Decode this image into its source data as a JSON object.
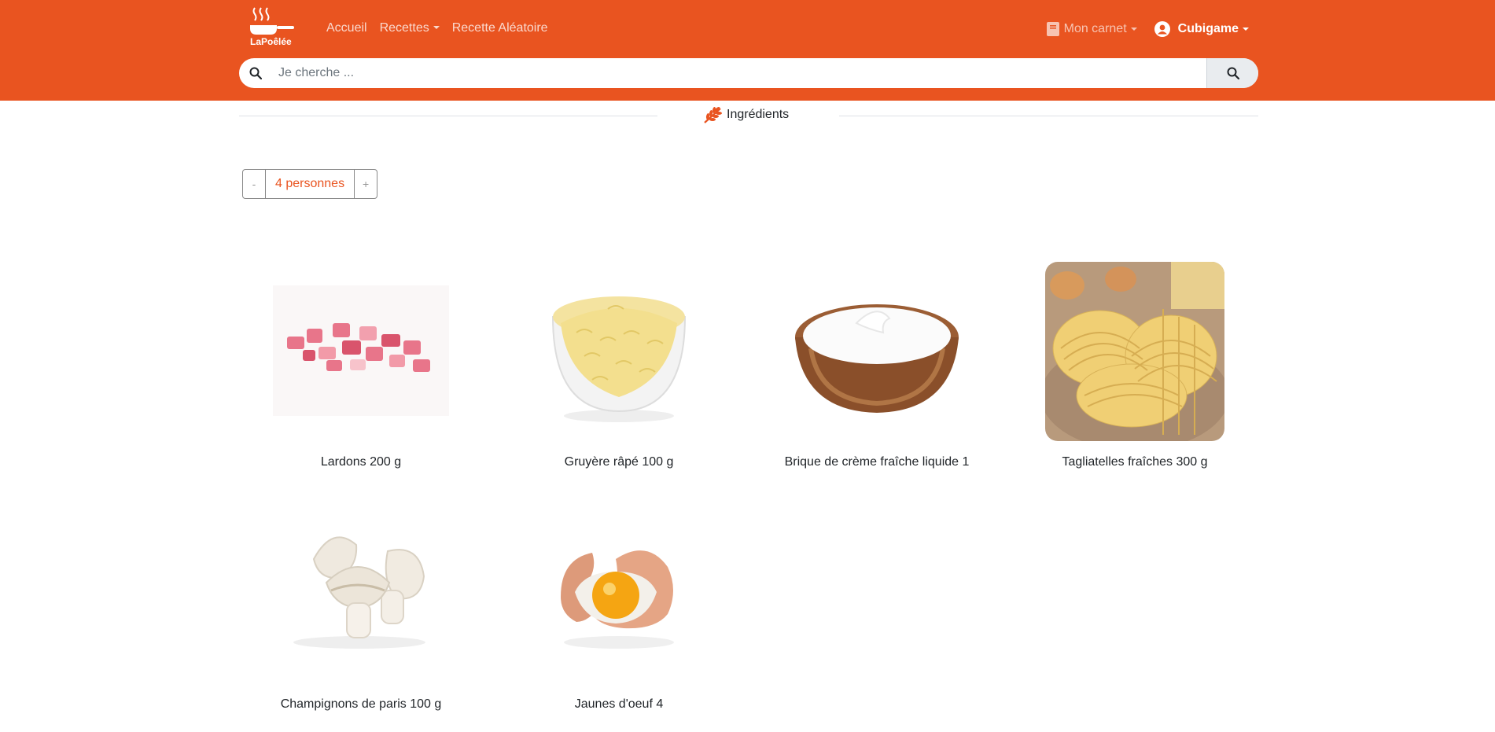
{
  "brand": {
    "name": "LaPoêlée"
  },
  "nav": {
    "links": [
      {
        "label": "Accueil"
      },
      {
        "label": "Recettes"
      },
      {
        "label": "Recette Aléatoire"
      }
    ],
    "carnet_label": "Mon carnet",
    "user_label": "Cubigame"
  },
  "search": {
    "placeholder": "Je cherche ..."
  },
  "section": {
    "title": "Ingrédients"
  },
  "servings": {
    "minus": "-",
    "value": "4 personnes",
    "plus": "+"
  },
  "ingredients": [
    {
      "label": "Lardons 200 g",
      "icon": "bacon-image"
    },
    {
      "label": "Gruyère râpé 100 g",
      "icon": "cheese-image"
    },
    {
      "label": "Brique de crème fraîche liquide 1",
      "icon": "cream-image"
    },
    {
      "label": "Tagliatelles fraîches 300 g",
      "icon": "pasta-image"
    },
    {
      "label": "Champignons de paris 100 g",
      "icon": "mushroom-image"
    },
    {
      "label": "Jaunes d'oeuf 4",
      "icon": "egg-image"
    }
  ],
  "colors": {
    "primary": "#e95420",
    "white": "#ffffff"
  }
}
